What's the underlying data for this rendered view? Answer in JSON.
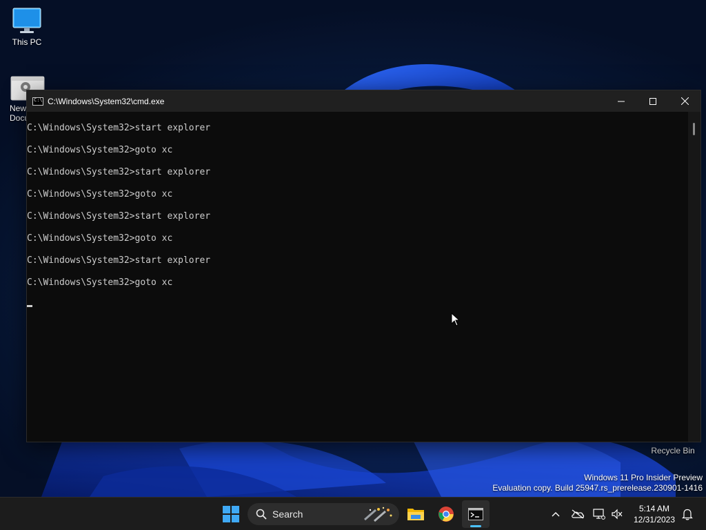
{
  "desktop": {
    "icons": [
      {
        "label": "This PC",
        "icon": "monitor-icon"
      },
      {
        "label": "New\nDocu",
        "icon": "settings-document-icon"
      }
    ],
    "recycle_bin_label": "Recycle Bin",
    "watermark": {
      "line1": "Windows 11 Pro Insider Preview",
      "line2": "Evaluation copy. Build 25947.rs_prerelease.230901-1416"
    }
  },
  "cmd_window": {
    "title": "C:\\Windows\\System32\\cmd.exe",
    "lines": [
      "C:\\Windows\\System32>start explorer",
      "C:\\Windows\\System32>goto xc",
      "C:\\Windows\\System32>start explorer",
      "C:\\Windows\\System32>goto xc",
      "C:\\Windows\\System32>start explorer",
      "C:\\Windows\\System32>goto xc",
      "C:\\Windows\\System32>start explorer",
      "C:\\Windows\\System32>goto xc"
    ],
    "controls": [
      "minimize-icon",
      "maximize-icon",
      "close-icon"
    ]
  },
  "taskbar": {
    "search_label": "Search",
    "apps": [
      "file-explorer-icon",
      "chrome-icon",
      "terminal-icon"
    ],
    "clock": {
      "time": "5:14 AM",
      "date": "12/31/2023"
    },
    "tray_icons": [
      "chevron-up-icon",
      "onedrive-offline-icon",
      "network-icon",
      "volume-muted-icon",
      "notification-bell-icon"
    ]
  },
  "colors": {
    "console_bg": "#0c0c0c",
    "console_text": "#cccccc",
    "titlebar_bg": "#202020",
    "taskbar_bg": "#1c1c1c",
    "accent": "#4cc2ff"
  }
}
